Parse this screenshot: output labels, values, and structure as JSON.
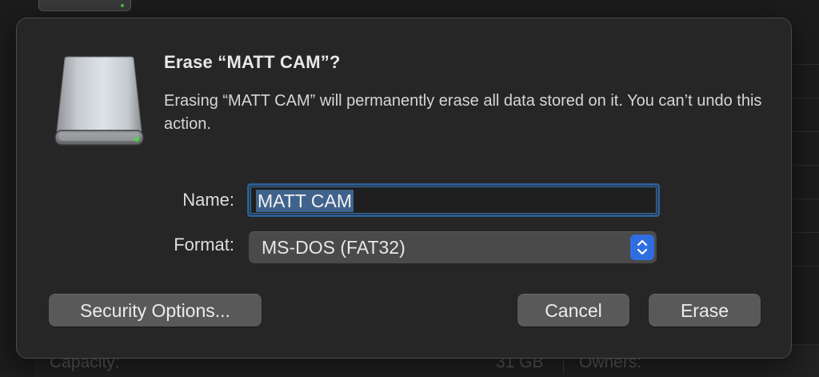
{
  "background": {
    "capacity_label": "Capacity:",
    "capacity_value": "31 GB",
    "owners_label": "Owners:"
  },
  "dialog": {
    "title": "Erase “MATT CAM”?",
    "message": "Erasing “MATT CAM” will permanently erase all data stored on it. You can’t undo this action.",
    "icon": "external-drive-icon",
    "name_label": "Name:",
    "name_value": "MATT CAM",
    "format_label": "Format:",
    "format_value": "MS-DOS (FAT32)",
    "buttons": {
      "security": "Security Options...",
      "cancel": "Cancel",
      "erase": "Erase"
    }
  },
  "colors": {
    "accent": "#2f6ee0",
    "selection": "#3f638c",
    "focus_ring": "#2c5d93",
    "dialog_bg": "#262626",
    "button_bg": "#595959"
  }
}
